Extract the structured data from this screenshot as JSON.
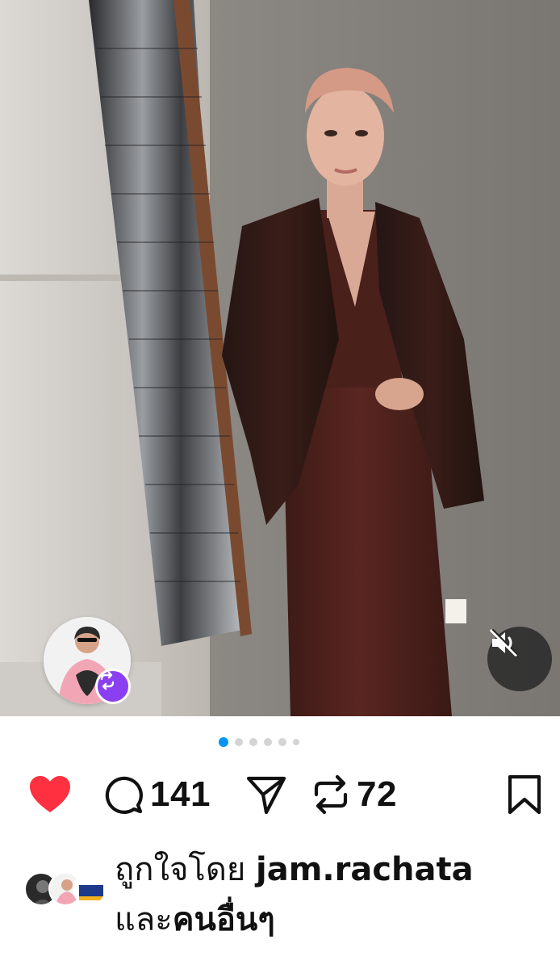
{
  "post": {
    "media": {
      "description_icon": "photo",
      "carousel": {
        "total": 6,
        "active_index": 0
      }
    },
    "collab_badge_icon": "remix-icon",
    "mute_icon": "speaker-muted-icon",
    "actions": {
      "like_icon": "heart-filled-icon",
      "like_color": "#ff3040",
      "comment_icon": "comment-icon",
      "comment_count": "141",
      "share_icon": "send-icon",
      "repost_icon": "repost-icon",
      "repost_count": "72",
      "save_icon": "bookmark-icon"
    },
    "likes": {
      "prefix": "ถูกใจโดย",
      "username": "jam.rachata",
      "connector": "และ",
      "others": "คนอื่นๆ"
    }
  }
}
